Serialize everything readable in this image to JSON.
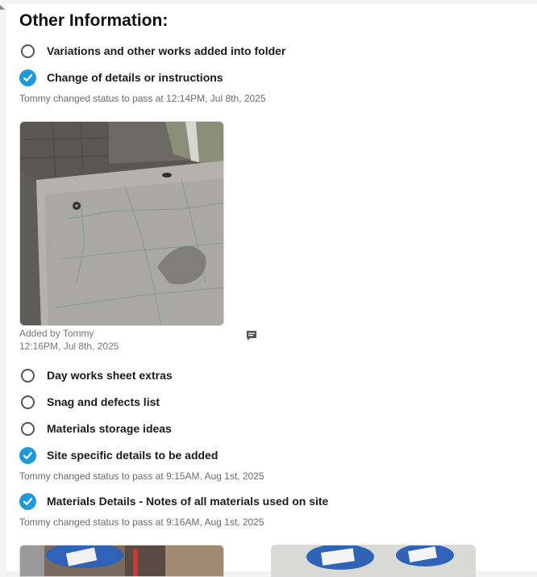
{
  "section": {
    "title": "Other Information:"
  },
  "items": [
    {
      "label": "Variations and other works added into folder",
      "checked": false
    },
    {
      "label": "Change of details or instructions",
      "checked": true,
      "status": "Tommy changed status to pass at 12:14PM, Jul 8th, 2025"
    },
    {
      "label": "Day works sheet extras",
      "checked": false
    },
    {
      "label": "Snag and defects list",
      "checked": false
    },
    {
      "label": "Materials storage ideas",
      "checked": false
    },
    {
      "label": "Site specific details to be added",
      "checked": true,
      "status": "Tommy changed status to pass at 9:15AM, Aug 1st, 2025"
    },
    {
      "label": "Materials Details - Notes of all materials used on site",
      "checked": true,
      "status": "Tommy changed status to pass at 9:16AM, Aug 1st, 2025"
    }
  ],
  "attachment": {
    "added_by": "Added by Tommy",
    "timestamp": "12:16PM, Jul 8th, 2025"
  },
  "icons": {
    "comment": "comment-icon",
    "checked": "checkmark-icon"
  },
  "colors": {
    "accent": "#1f9ad6"
  }
}
